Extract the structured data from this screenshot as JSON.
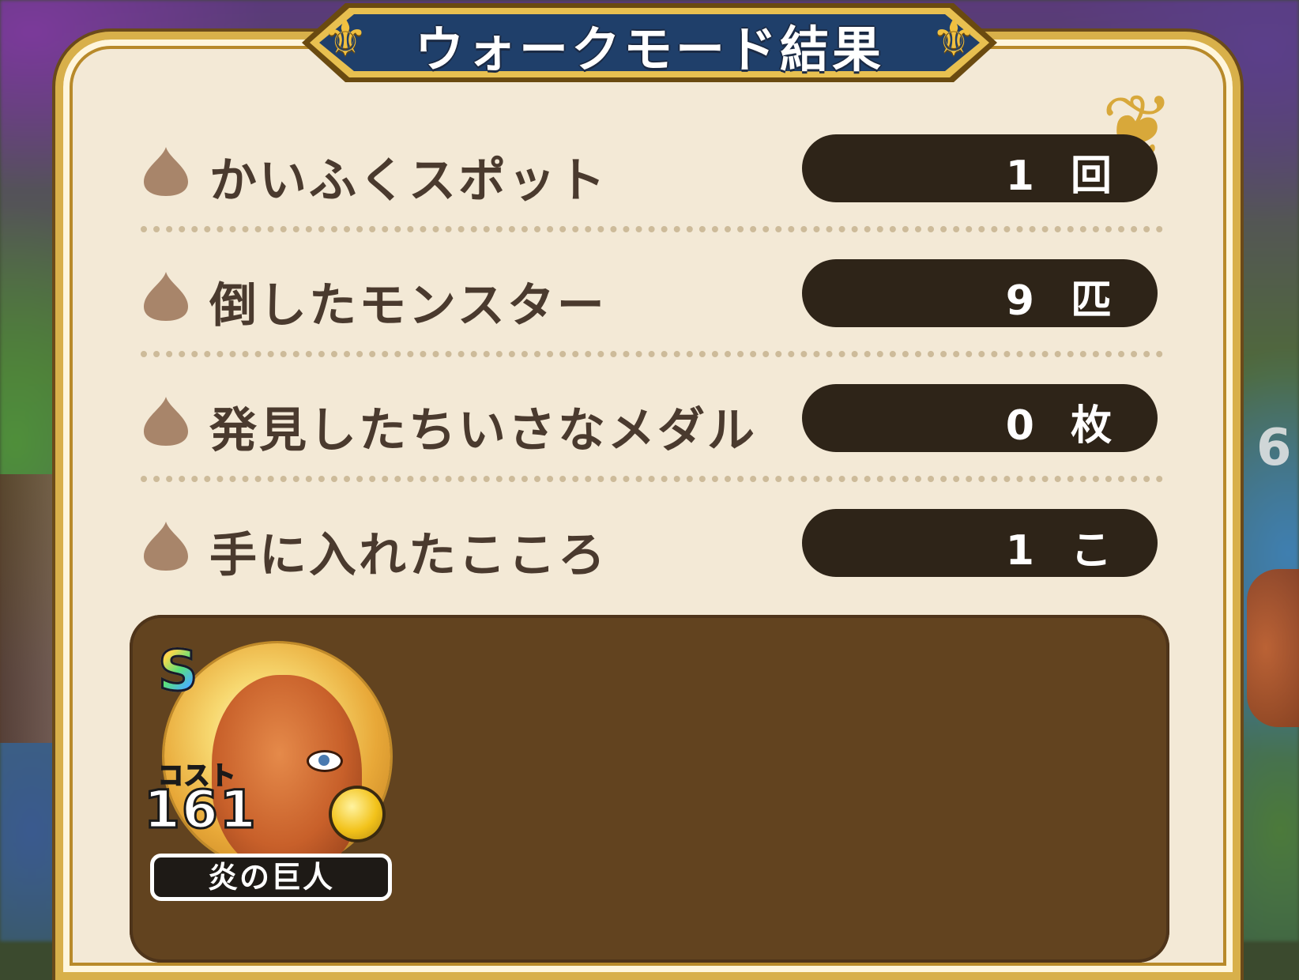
{
  "title": "ウォークモード結果",
  "stats": [
    {
      "label": "かいふくスポット",
      "value": "1 回"
    },
    {
      "label": "倒したモンスター",
      "value": "9 匹"
    },
    {
      "label": "発見したちいさなメダル",
      "value": "0 枚"
    },
    {
      "label": "手に入れたこころ",
      "value": "1 こ"
    }
  ],
  "heart": {
    "rank": "S",
    "cost_label": "コスト",
    "cost": "161",
    "name": "炎の巨人"
  },
  "background": {
    "partial_number": "6"
  }
}
